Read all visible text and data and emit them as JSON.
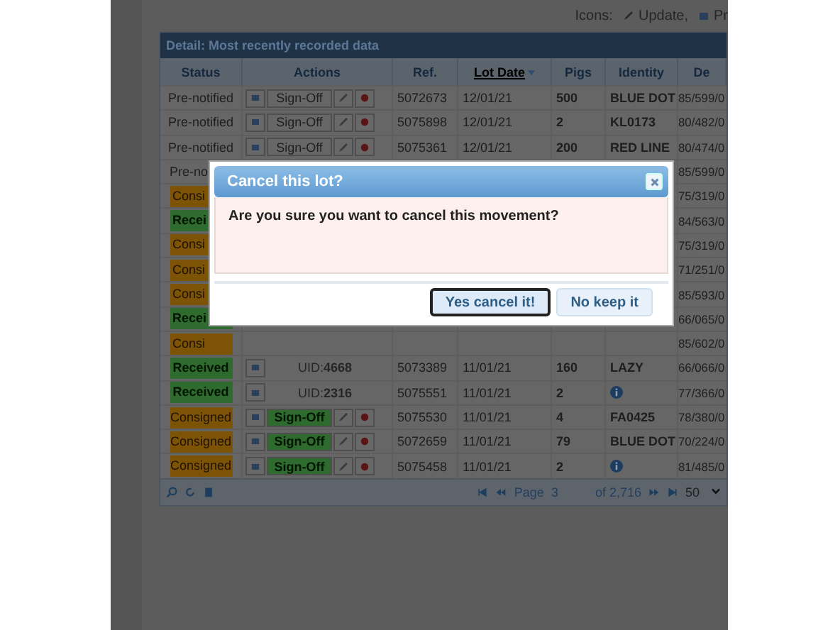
{
  "toolbar": {
    "label": "Icons:",
    "items": [
      "Update,",
      "Pr"
    ]
  },
  "table": {
    "title": "Detail: Most recently recorded data",
    "columns": [
      {
        "label": "Status",
        "sorted": false
      },
      {
        "label": "Actions",
        "sorted": false
      },
      {
        "label": "Ref.",
        "sorted": false
      },
      {
        "label": "Lot Date",
        "sorted": true
      },
      {
        "label": "Pigs",
        "sorted": false
      },
      {
        "label": "Identity",
        "sorted": false
      },
      {
        "label": "De",
        "sorted": false
      }
    ],
    "rows": [
      {
        "status": "Pre-notified",
        "kind": "prenotified",
        "actions": {
          "kind": "signoff",
          "label": "Sign-Off"
        },
        "ref": "5072673",
        "lot_date": "12/01/21",
        "pigs": "500",
        "identity": "BLUE DOT",
        "column_7": "85/599/0"
      },
      {
        "status": "Pre-notified",
        "kind": "prenotified",
        "actions": {
          "kind": "signoff",
          "label": "Sign-Off"
        },
        "ref": "5075898",
        "lot_date": "12/01/21",
        "pigs": "2",
        "identity": "KL0173",
        "column_7": "80/482/0"
      },
      {
        "status": "Pre-notified",
        "kind": "prenotified",
        "actions": {
          "kind": "signoff",
          "label": "Sign-Off"
        },
        "ref": "5075361",
        "lot_date": "12/01/21",
        "pigs": "200",
        "identity": "RED LINE",
        "column_7": "80/474/0"
      },
      {
        "status": "Pre-no",
        "kind": "prenotified",
        "column_7": "85/599/0"
      },
      {
        "status": "Consi",
        "kind": "consigned",
        "column_7": "75/319/0"
      },
      {
        "status": "Recei",
        "kind": "received",
        "column_7": "84/563/0"
      },
      {
        "status": "Consi",
        "kind": "consigned",
        "column_7": "75/319/0"
      },
      {
        "status": "Consi",
        "kind": "consigned",
        "column_7": "71/251/0"
      },
      {
        "status": "Consi",
        "kind": "consigned",
        "column_7": "85/593/0"
      },
      {
        "status": "Recei",
        "kind": "received",
        "column_7": "66/065/0"
      },
      {
        "status": "Consi",
        "kind": "consigned",
        "column_7": "85/602/0"
      },
      {
        "status": "Received",
        "kind": "received",
        "actions": {
          "kind": "uid",
          "label": "UID:**4668**"
        },
        "ref": "5073389",
        "lot_date": "11/01/21",
        "pigs": "160",
        "identity": "LAZY",
        "column_7": "66/066/0"
      },
      {
        "status": "Received",
        "kind": "received",
        "actions": {
          "kind": "uid",
          "label": "UID:**2316**"
        },
        "ref": "5075551",
        "lot_date": "11/01/21",
        "pigs": "2",
        "info_icon": true,
        "column_7": "77/366/0"
      },
      {
        "status": "Consigned",
        "kind": "consigned",
        "actions": {
          "kind": "signoff",
          "label": "Sign-Off"
        },
        "ref": "5075530",
        "lot_date": "11/01/21",
        "pigs": "4",
        "identity": "FA0425",
        "column_7": "78/380/0"
      },
      {
        "status": "Consigned",
        "kind": "consigned",
        "actions": {
          "kind": "signoff",
          "label": "Sign-Off"
        },
        "ref": "5072659",
        "lot_date": "11/01/21",
        "pigs": "79",
        "identity": "BLUE DOT",
        "column_7": "70/224/0"
      },
      {
        "status": "Consigned",
        "kind": "consigned",
        "actions": {
          "kind": "signoff",
          "label": "Sign-Off"
        },
        "ref": "5075458",
        "lot_date": "11/01/21",
        "pigs": "2",
        "info_icon": true,
        "column_7": "81/485/0"
      }
    ]
  },
  "pager": {
    "page_label": "Page",
    "page": "3",
    "of": "of 2,716",
    "page_size": "50"
  },
  "dialog": {
    "title": "Cancel this lot?",
    "message": "Are you sure you want to cancel this movement?",
    "buttons": [
      {
        "label": "Yes cancel it!",
        "selected": true
      },
      {
        "label": "No keep it",
        "selected": false
      }
    ]
  }
}
